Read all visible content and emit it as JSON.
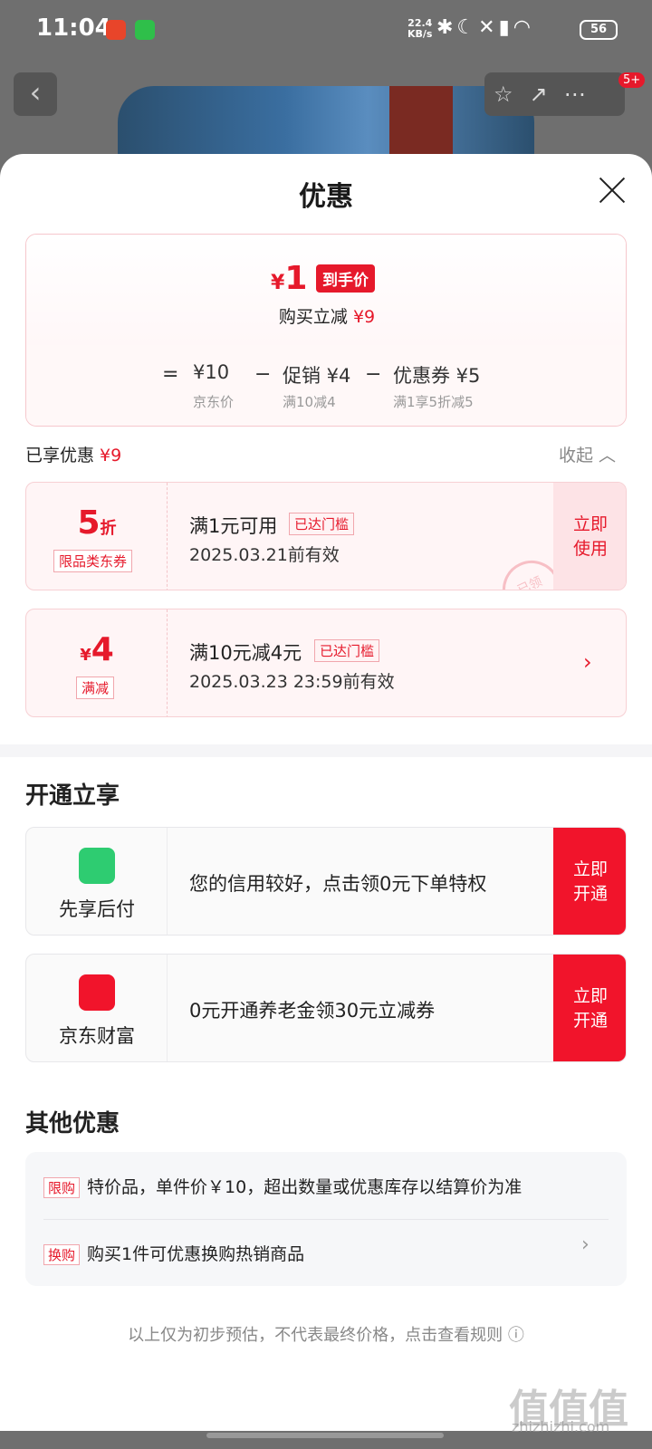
{
  "status_bar": {
    "time": "11:04",
    "speed": "22.4",
    "speed_unit": "KB/s",
    "battery": "56"
  },
  "nav": {
    "back": "‹",
    "badge": "5+"
  },
  "sheet": {
    "title": "优惠",
    "price": {
      "yen": "¥",
      "value": "1",
      "tag": "到手价",
      "sub_label": "购买立减",
      "sub_value": "¥9"
    },
    "breakdown": [
      {
        "op": "=",
        "main": "¥10",
        "sub": "京东价"
      },
      {
        "op": "−",
        "main": "促销 ¥4",
        "sub": "满10减4"
      },
      {
        "op": "−",
        "main": "优惠券 ¥5",
        "sub": "满1享5折减5"
      }
    ],
    "enjoyed": {
      "label": "已享优惠",
      "value": "¥9",
      "collapse": "收起 ︿"
    },
    "coupons": [
      {
        "value": "5",
        "unit": "折",
        "tag": "限品类东券",
        "title": "满1元可用",
        "reach": "已达门槛",
        "date": "2025.03.21前有效",
        "action": "立即使用",
        "stamp": "已领"
      },
      {
        "prefix": "¥",
        "value": "4",
        "tag": "满减",
        "title": "满10元减4元",
        "reach": "已达门槛",
        "date": "2025.03.23 23:59前有效",
        "arrow": "›"
      }
    ],
    "open_section": {
      "title": "开通立享",
      "items": [
        {
          "name": "先享后付",
          "text": "您的信用较好，点击领0元下单特权",
          "action": "立即开通",
          "color": "#2ecc71"
        },
        {
          "name": "京东财富",
          "text": "0元开通养老金领30元立减券",
          "action": "立即开通",
          "color": "#f1142b"
        }
      ]
    },
    "other_section": {
      "title": "其他优惠",
      "rows": [
        {
          "tag": "限购",
          "text": "特价品，单件价￥10，超出数量或优惠库存以结算价为准"
        },
        {
          "tag": "换购",
          "text": "购买1件可优惠换购热销商品",
          "arrow": "›"
        }
      ]
    },
    "footnote": "以上仅为初步预估，不代表最终价格，点击查看规则 ⓘ"
  },
  "watermark": {
    "text": "值值值",
    "url": "zhizhizhi.com"
  }
}
